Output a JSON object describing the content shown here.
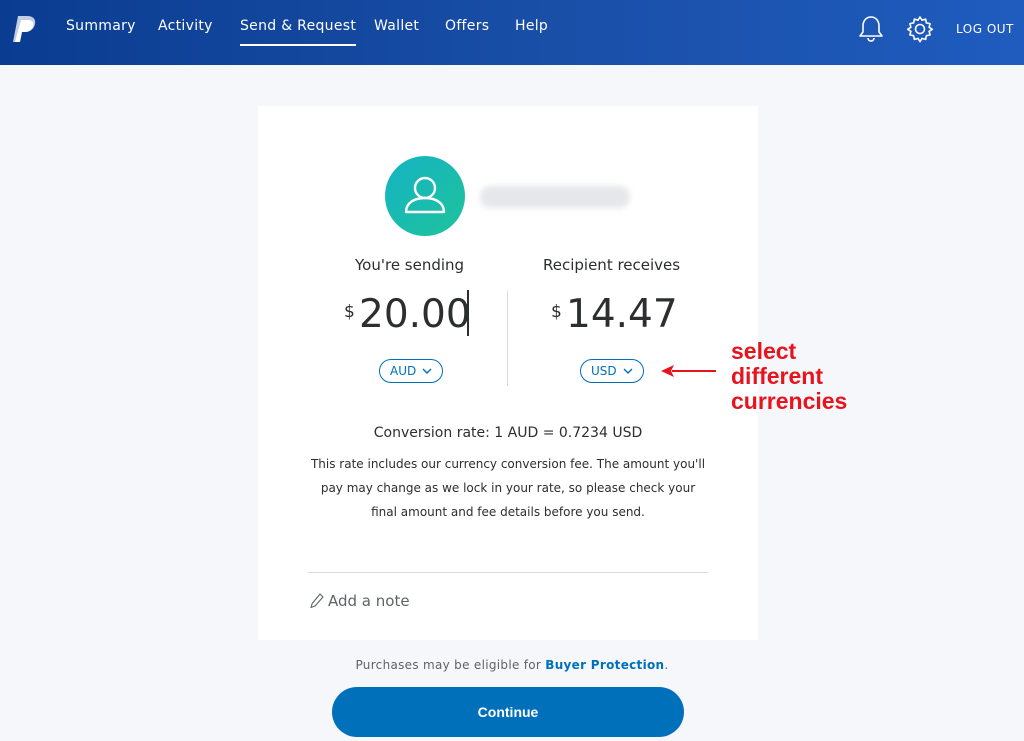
{
  "nav": {
    "items": [
      {
        "label": "Summary"
      },
      {
        "label": "Activity"
      },
      {
        "label": "Send & Request"
      },
      {
        "label": "Wallet"
      },
      {
        "label": "Offers"
      },
      {
        "label": "Help"
      }
    ],
    "active_index": 2,
    "logout_label": "LOG OUT",
    "icons": [
      "paypal-logo",
      "bell-icon",
      "gear-icon"
    ]
  },
  "send": {
    "sending_label": "You're sending",
    "sending_symbol": "$",
    "sending_amount": "20.00",
    "sending_currency": "AUD",
    "receiving_label": "Recipient receives",
    "receiving_symbol": "$",
    "receiving_amount": "14.47",
    "receiving_currency": "USD",
    "conversion_rate": "Conversion rate: 1 AUD = 0.7234 USD",
    "fee_note": "This rate includes our currency conversion fee. The amount you'll pay may change as we lock in your rate, so please check your final amount and fee details before you send.",
    "add_note_label": "Add a note"
  },
  "annotation": {
    "lines": [
      "select",
      "different",
      "currencies"
    ],
    "color": "#e8141d"
  },
  "footer": {
    "buyer_protection_prefix": "Purchases may be eligible for ",
    "buyer_protection_link": "Buyer Protection",
    "buyer_protection_suffix": ".",
    "continue_label": "Continue"
  },
  "colors": {
    "brand_blue": "#0070ba",
    "nav_dark": "#0a3d91",
    "avatar_start": "#14b3c4",
    "avatar_end": "#1fc39b"
  }
}
